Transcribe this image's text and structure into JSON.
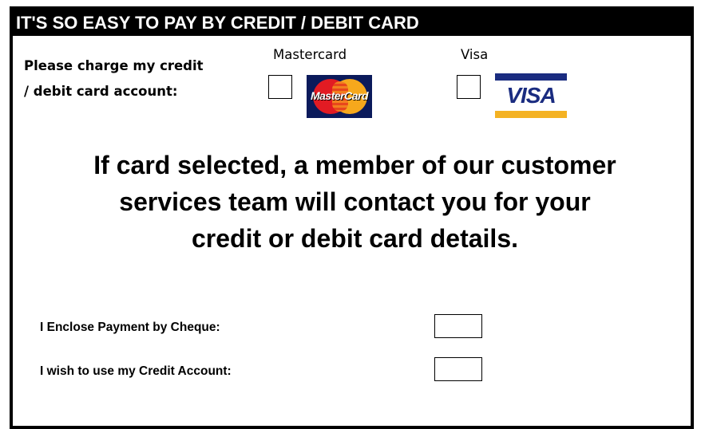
{
  "header": {
    "title": "IT'S SO EASY TO PAY BY CREDIT / DEBIT CARD"
  },
  "card_section": {
    "label_line1": "Please charge my credit",
    "label_line2": "/ debit card account:",
    "cards": [
      {
        "name": "Mastercard",
        "logo_text": "MasterCard",
        "logo_icon": "mastercard-logo"
      },
      {
        "name": "Visa",
        "logo_text": "VISA",
        "logo_icon": "visa-logo"
      }
    ]
  },
  "notice": {
    "line1": "If card selected, a member of our customer",
    "line2": "services team will contact you for your",
    "line3": "credit or debit card details."
  },
  "options": [
    {
      "label": "I Enclose Payment by Cheque:"
    },
    {
      "label": "I wish to use my Credit Account:"
    }
  ],
  "colors": {
    "header_bg": "#000000",
    "header_text": "#ffffff",
    "mastercard_red": "#e21b23",
    "mastercard_yellow": "#f6a81c",
    "visa_blue": "#1a2c80",
    "visa_gold": "#f4b223"
  }
}
